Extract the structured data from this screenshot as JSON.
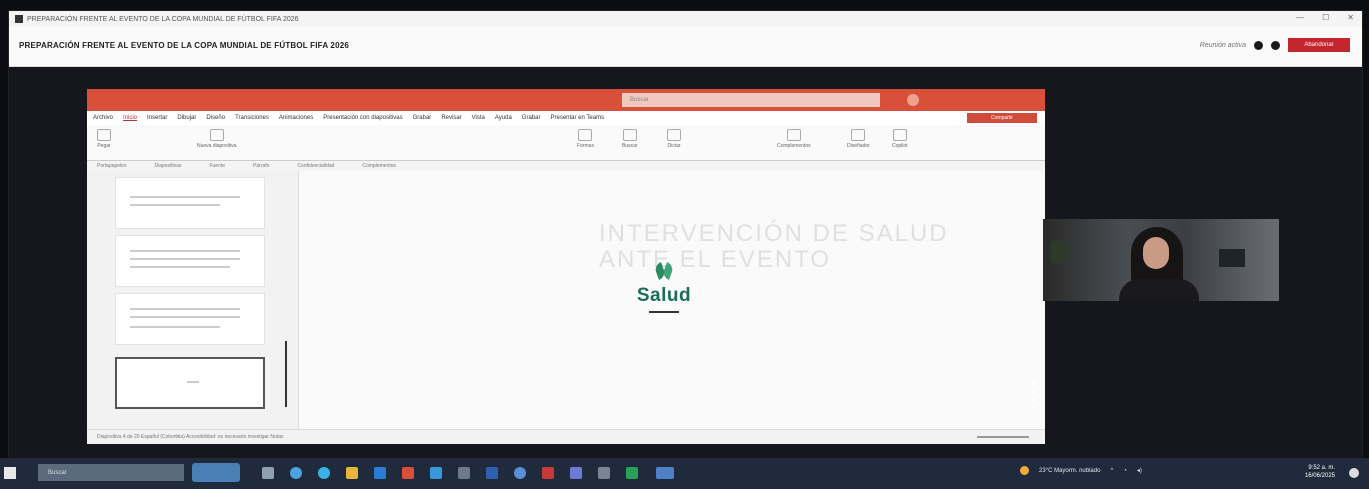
{
  "window": {
    "title": "PREPARACIÓN FRENTE AL EVENTO DE LA COPA MUNDIAL DE FÚTBOL FIFA 2026",
    "meeting_title": "PREPARACIÓN FRENTE AL EVENTO DE LA COPA MUNDIAL DE FÚTBOL FIFA 2026",
    "status": "Reunión activa",
    "leave_label": "Abandonar"
  },
  "powerpoint": {
    "search_placeholder": "Buscar",
    "menu": [
      "Archivo",
      "Inicio",
      "Insertar",
      "Dibujar",
      "Diseño",
      "Transiciones",
      "Animaciones",
      "Presentación con diapositivas",
      "Grabar",
      "Revisar",
      "Vista",
      "Ayuda",
      "Grabar",
      "Presentar en Teams"
    ],
    "share_label": "Compartir",
    "ribbon": {
      "paste": "Pegar",
      "new_slide": "Nueva diapositiva",
      "shapes": "Formas",
      "find": "Buscar",
      "dictate": "Dictar",
      "designer": "Diseñador",
      "copilot": "Copilot",
      "complements": "Complementos"
    },
    "groups": [
      "Portapapeles",
      "Diapositivas",
      "Fuente",
      "Párrafo",
      "Confidencialidad",
      "Complementos"
    ],
    "slide": {
      "title_line1": "INTERVENCIÓN DE SALUD",
      "title_line2": "ANTE EL EVENTO",
      "logo_text": "Salud"
    },
    "status_bar": "Diapositiva 4 de 20   Español (Colombia)   Accesibilidad: es necesario investigar   Notas"
  },
  "taskbar": {
    "search_placeholder": "Buscar",
    "weather": "23°C  Mayorm. nublado",
    "time": "9:52 a. m.",
    "date": "16/06/2025"
  },
  "colors": {
    "powerpoint_red": "#d9503a",
    "salud_green": "#1d6d5a",
    "leave_red": "#c4262e"
  }
}
